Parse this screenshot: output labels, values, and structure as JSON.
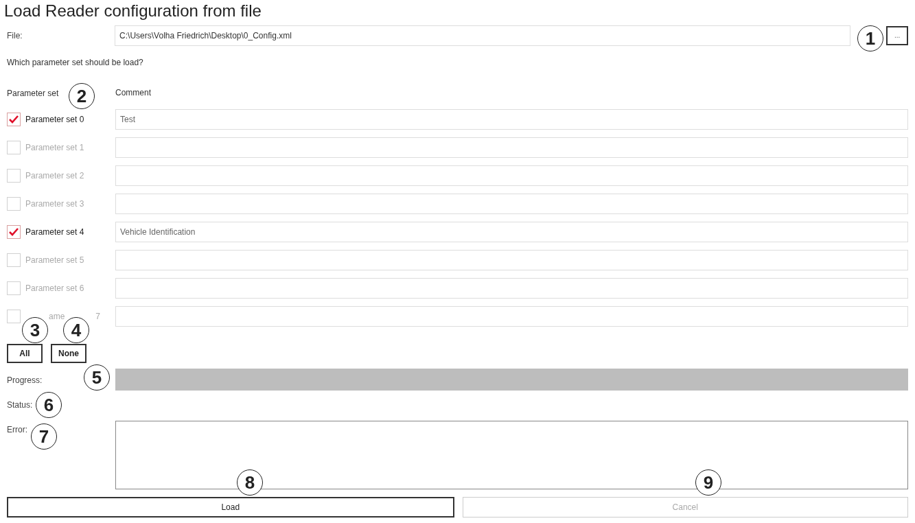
{
  "title": "Load Reader configuration from file",
  "file": {
    "label": "File:",
    "value": "C:\\Users\\Volha Friedrich\\Desktop\\0_Config.xml",
    "browse_button": "..."
  },
  "question": "Which parameter set should be load?",
  "columns": [
    "Parameter set",
    "Comment"
  ],
  "parameter_sets": [
    {
      "label": "Parameter set 0",
      "checked": true,
      "comment": "Test"
    },
    {
      "label": "Parameter set 1",
      "checked": false
    },
    {
      "label": "Parameter set 2",
      "checked": false
    },
    {
      "label": "Parameter set 3",
      "checked": false
    },
    {
      "label": "Parameter set 4",
      "checked": true,
      "comment": "Vehicle Identification"
    },
    {
      "label": "Parameter set 5",
      "checked": false
    },
    {
      "label": "Parameter set 6",
      "checked": false
    },
    {
      "kind": "covered",
      "label_parts": [
        "ame",
        "7"
      ],
      "checked": false
    }
  ],
  "select_buttons": [
    "All",
    "None"
  ],
  "progress": {
    "label": "Progress:",
    "level": 0
  },
  "status": {
    "label": "Status:"
  },
  "error": {
    "label": "Error:"
  },
  "actions": [
    {
      "label": "Load",
      "disabled": false
    },
    {
      "label": "Cancel",
      "disabled": true
    }
  ],
  "callouts": [
    "1",
    "2",
    "3",
    "4",
    "5",
    "6",
    "7",
    "8",
    "9"
  ]
}
